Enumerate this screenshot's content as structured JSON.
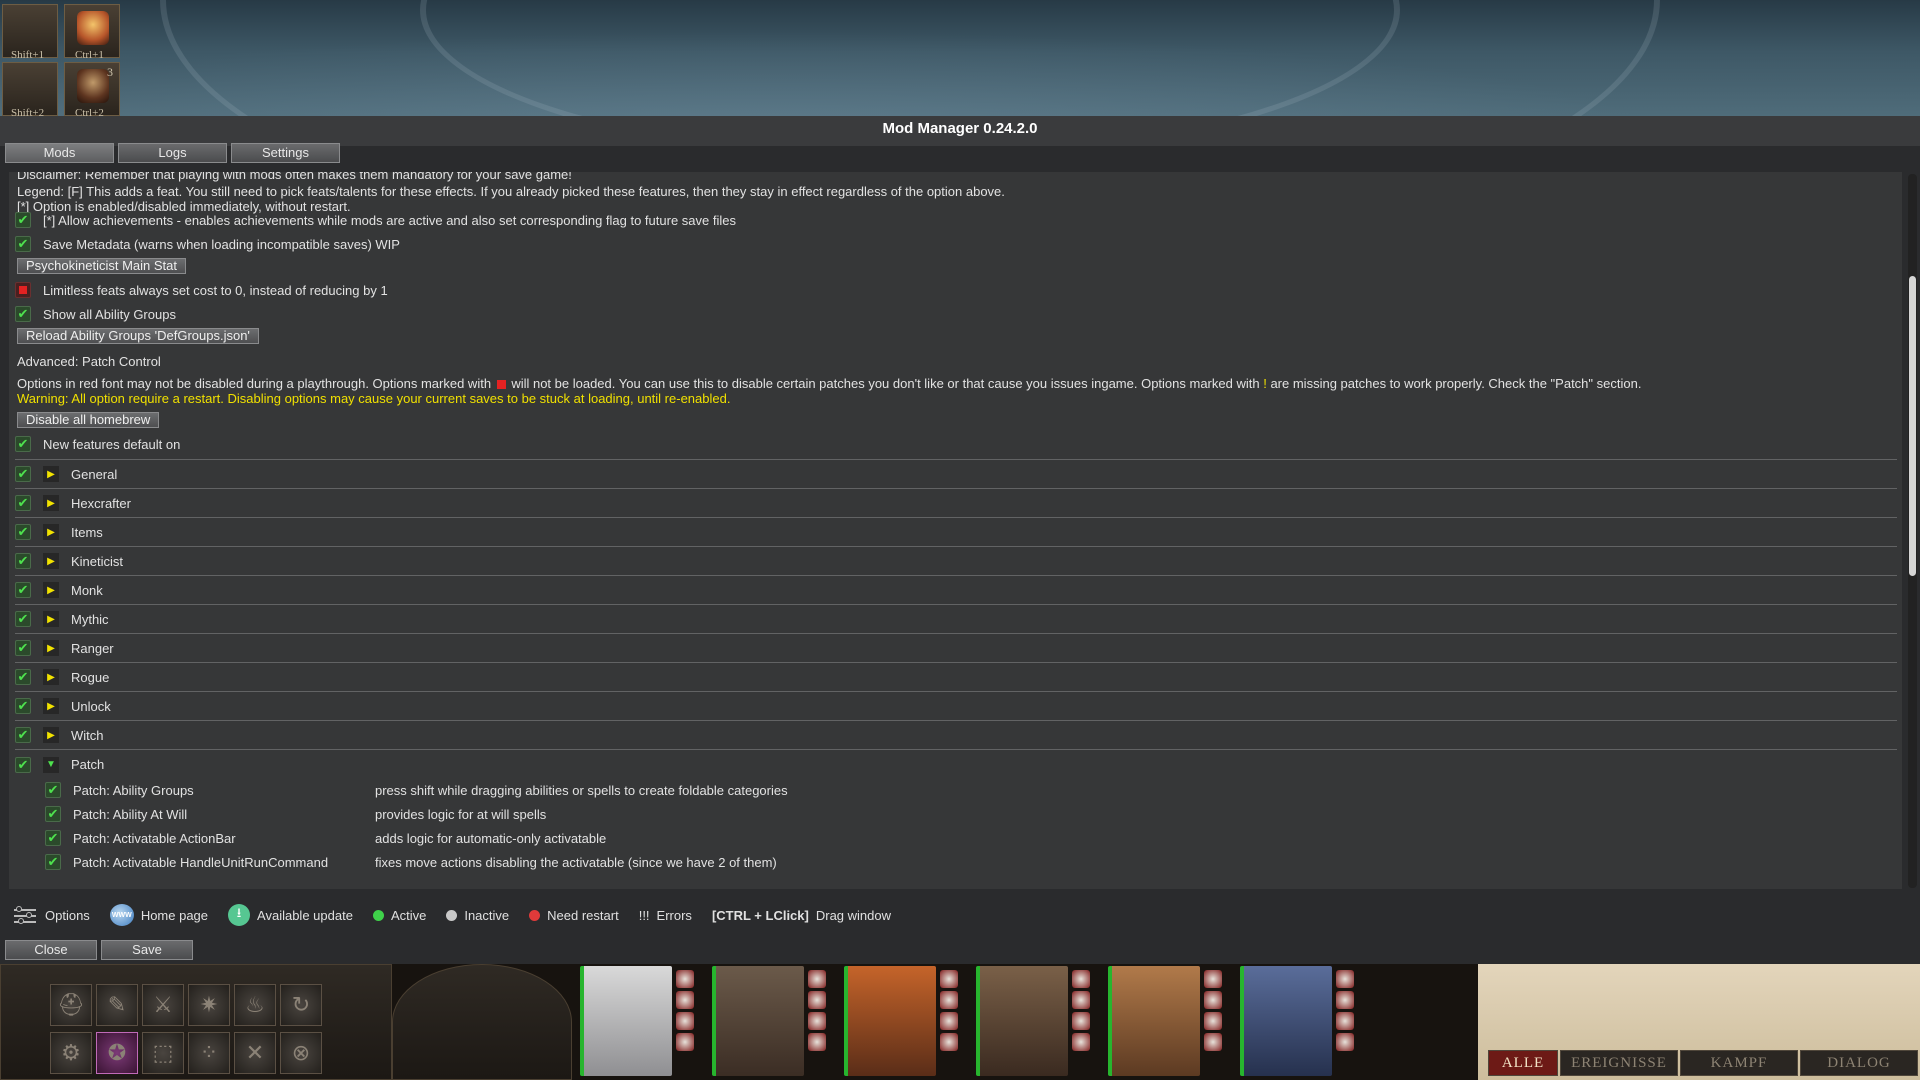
{
  "window": {
    "title": "Mod Manager 0.24.2.0",
    "tabs": [
      "Mods",
      "Logs",
      "Settings"
    ]
  },
  "hotbar": {
    "keys": [
      "Shift+1",
      "Ctrl+1",
      "Shift+2",
      "Ctrl+2"
    ],
    "badge": "3"
  },
  "content": {
    "disclaimer": "Disclaimer: Remember that playing with mods often makes them mandatory for your save game!",
    "legend_feat": "Legend: [F] This adds a feat. You still need to pick feats/talents for these effects. If you already picked these features, then they stay in effect regardless of the option above.",
    "legend_star": "[*] Option is enabled/disabled immediately, without restart.",
    "allow_achievements": "[*] Allow achievements - enables achievements while mods are active and also set corresponding flag to future save files",
    "save_metadata": "Save Metadata (warns when loading incompatible saves) WIP",
    "psychokineticist_button": "Psychokineticist Main Stat",
    "limitless_feats": "Limitless feats always set cost to 0, instead of reducing by 1",
    "show_ability_groups": "Show all Ability Groups",
    "reload_button": "Reload Ability Groups 'DefGroups.json'",
    "advanced_heading": "Advanced: Patch Control",
    "options_text_a": "Options in red font may not be disabled during a playthrough. Options marked with",
    "options_text_b": "will not be loaded. You can use this to disable certain patches you don't like or that cause you issues ingame. Options marked with",
    "options_text_excl": "!",
    "options_text_c": "are missing patches to work properly. Check the \"Patch\" section.",
    "warning": "Warning: All option require a restart. Disabling options may cause your current saves to be stuck at loading, until re-enabled.",
    "disable_homebrew_button": "Disable all homebrew",
    "new_features": "New features default on",
    "categories": [
      "General",
      "Hexcrafter",
      "Items",
      "Kineticist",
      "Monk",
      "Mythic",
      "Ranger",
      "Rogue",
      "Unlock",
      "Witch"
    ],
    "patch_category": "Patch",
    "patches": [
      {
        "name": "Patch: Ability Groups",
        "desc": "press shift while dragging abilities or spells to create foldable categories"
      },
      {
        "name": "Patch: Ability At Will",
        "desc": "provides logic for at will spells"
      },
      {
        "name": "Patch: Activatable ActionBar",
        "desc": "adds logic for automatic-only activatable"
      },
      {
        "name": "Patch: Activatable HandleUnitRunCommand",
        "desc": "fixes move actions disabling the activatable (since we have 2 of them)"
      }
    ]
  },
  "legend_bar": {
    "options": "Options",
    "www": "WWW",
    "home_page": "Home page",
    "available_update": "Available update",
    "active": "Active",
    "inactive": "Inactive",
    "need_restart": "Need restart",
    "errors_mark": "!!!",
    "errors": "Errors",
    "shortcut": "[CTRL + LClick]",
    "drag_window": "Drag window"
  },
  "buttons": {
    "close": "Close",
    "save": "Save"
  },
  "chat_tabs": [
    "ALLE",
    "EREIGNISSE",
    "KAMPF",
    "DIALOG"
  ],
  "colors": {
    "active": "#3fd24a",
    "inactive": "#c8c8c8",
    "need_restart": "#e03a3a",
    "warning": "#f0e000",
    "check": "#4ee24e"
  }
}
